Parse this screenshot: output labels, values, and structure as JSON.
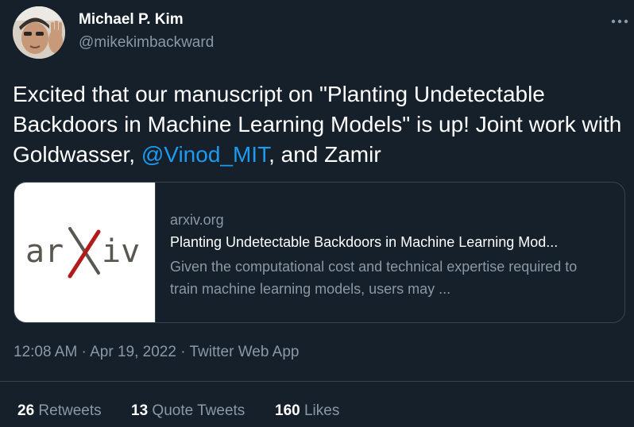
{
  "author": {
    "name": "Michael P. Kim",
    "handle": "@mikekimbackward"
  },
  "tweet": {
    "text_before": "Excited that our manuscript on \"Planting Undetectable Backdoors in Machine Learning Models\" is up!  Joint work with Goldwasser, ",
    "mention": "@Vinod_MIT",
    "text_after": ", and Zamir"
  },
  "card": {
    "logo_text_left": "ar",
    "logo_text_mid": "X",
    "logo_text_right": "iv",
    "domain": "arxiv.org",
    "title": "Planting Undetectable Backdoors in Machine Learning Mod...",
    "description": "Given the computational cost and technical expertise required to train machine learning models, users may ..."
  },
  "meta": {
    "time": "12:08 AM",
    "sep1": " · ",
    "date": "Apr 19, 2022",
    "sep2": " · ",
    "source": "Twitter Web App"
  },
  "stats": {
    "retweets_count": "26",
    "retweets_label": " Retweets",
    "quotes_count": "13",
    "quotes_label": " Quote Tweets",
    "likes_count": "160",
    "likes_label": " Likes"
  },
  "colors": {
    "background": "#15202b",
    "link": "#1d9bf0",
    "secondary_text": "#8b98a5",
    "border": "#38444d",
    "arxiv_red": "#b31b1b"
  },
  "icons": {
    "more": "more-horizontal-icon",
    "avatar": "user-avatar"
  }
}
